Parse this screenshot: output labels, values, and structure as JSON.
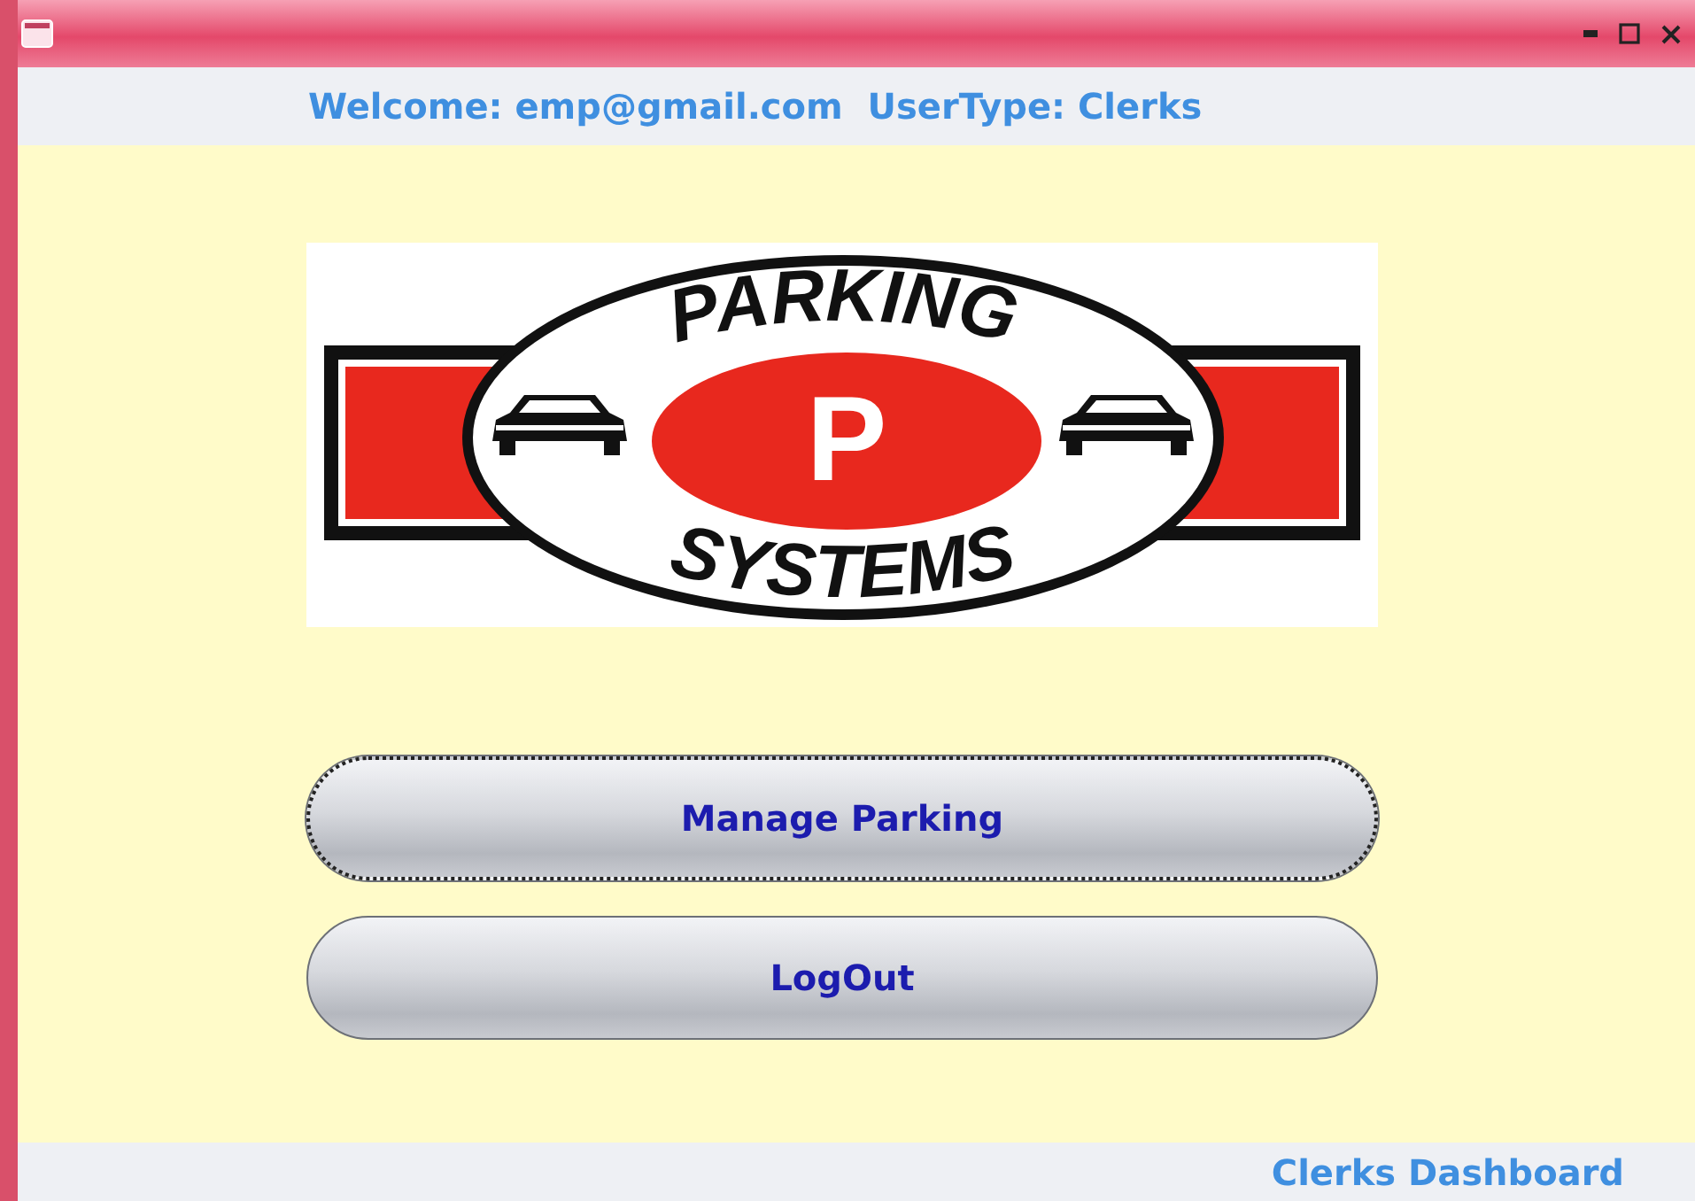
{
  "header": {
    "welcome": "Welcome: emp@gmail.com  UserType: Clerks"
  },
  "logo": {
    "top_text": "PARKING",
    "center_text": "P",
    "bottom_text": "SYSTEMS"
  },
  "buttons": [
    {
      "label": "Manage Parking",
      "focused": true
    },
    {
      "label": "LogOut",
      "focused": false
    }
  ],
  "footer": {
    "title": "Clerks Dashboard"
  }
}
